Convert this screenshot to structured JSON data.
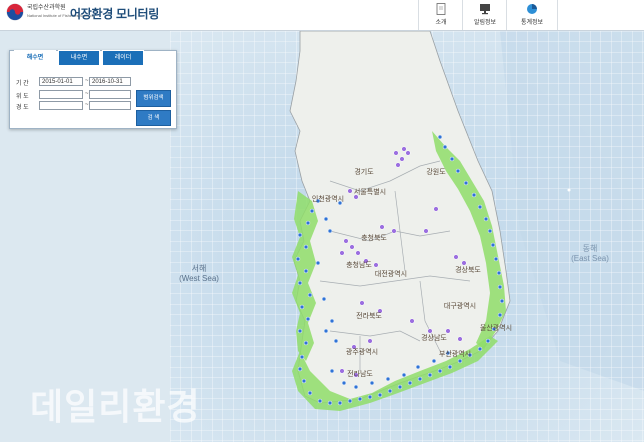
{
  "header": {
    "institution_ko": "국립수산과학원",
    "institution_en": "National Institute of Fisheries Science",
    "title": "어장환경 모니터링",
    "nav": [
      {
        "label": "소개",
        "icon": "document-icon"
      },
      {
        "label": "알림정보",
        "icon": "monitor-icon"
      },
      {
        "label": "통계정보",
        "icon": "pie-chart-icon"
      }
    ]
  },
  "search_panel": {
    "tabs": [
      "해수면",
      "내수면",
      "레이더"
    ],
    "active_tab": "해수면",
    "period_label": "기 간",
    "start_date": "2015-01-01",
    "end_date": "2016-10-31",
    "lat_label": "위 도",
    "lon_label": "경 도",
    "range_sep": "~",
    "range_search_label": "범위검색",
    "search_label": "검 색"
  },
  "map_labels": {
    "gyeonggi": "경기도",
    "gangwon": "강원도",
    "seoul": "서울특별시",
    "incheon": "인천광역시",
    "chungbuk": "충청북도",
    "chungnam": "충청남도",
    "daejeon": "대전광역시",
    "gyeongbuk": "경상북도",
    "jeonbuk": "전라북도",
    "daegu": "대구광역시",
    "ulsan": "울산광역시",
    "gwangju": "광주광역시",
    "gyeongnam": "경상남도",
    "busan": "부산광역시",
    "jeonnam": "전라남도",
    "west_sea_ko": "서해",
    "west_sea_en": "(West Sea)",
    "east_sea_ko": "동해",
    "east_sea_en": "(East Sea)"
  },
  "watermark": "데일리환경",
  "colors": {
    "marine_station": "#2f73d6",
    "inland_station": "#9b6ee0",
    "coastal_zone": "#8fdd6a",
    "grid": "#ffffff",
    "sea": "#dbe9f2"
  }
}
